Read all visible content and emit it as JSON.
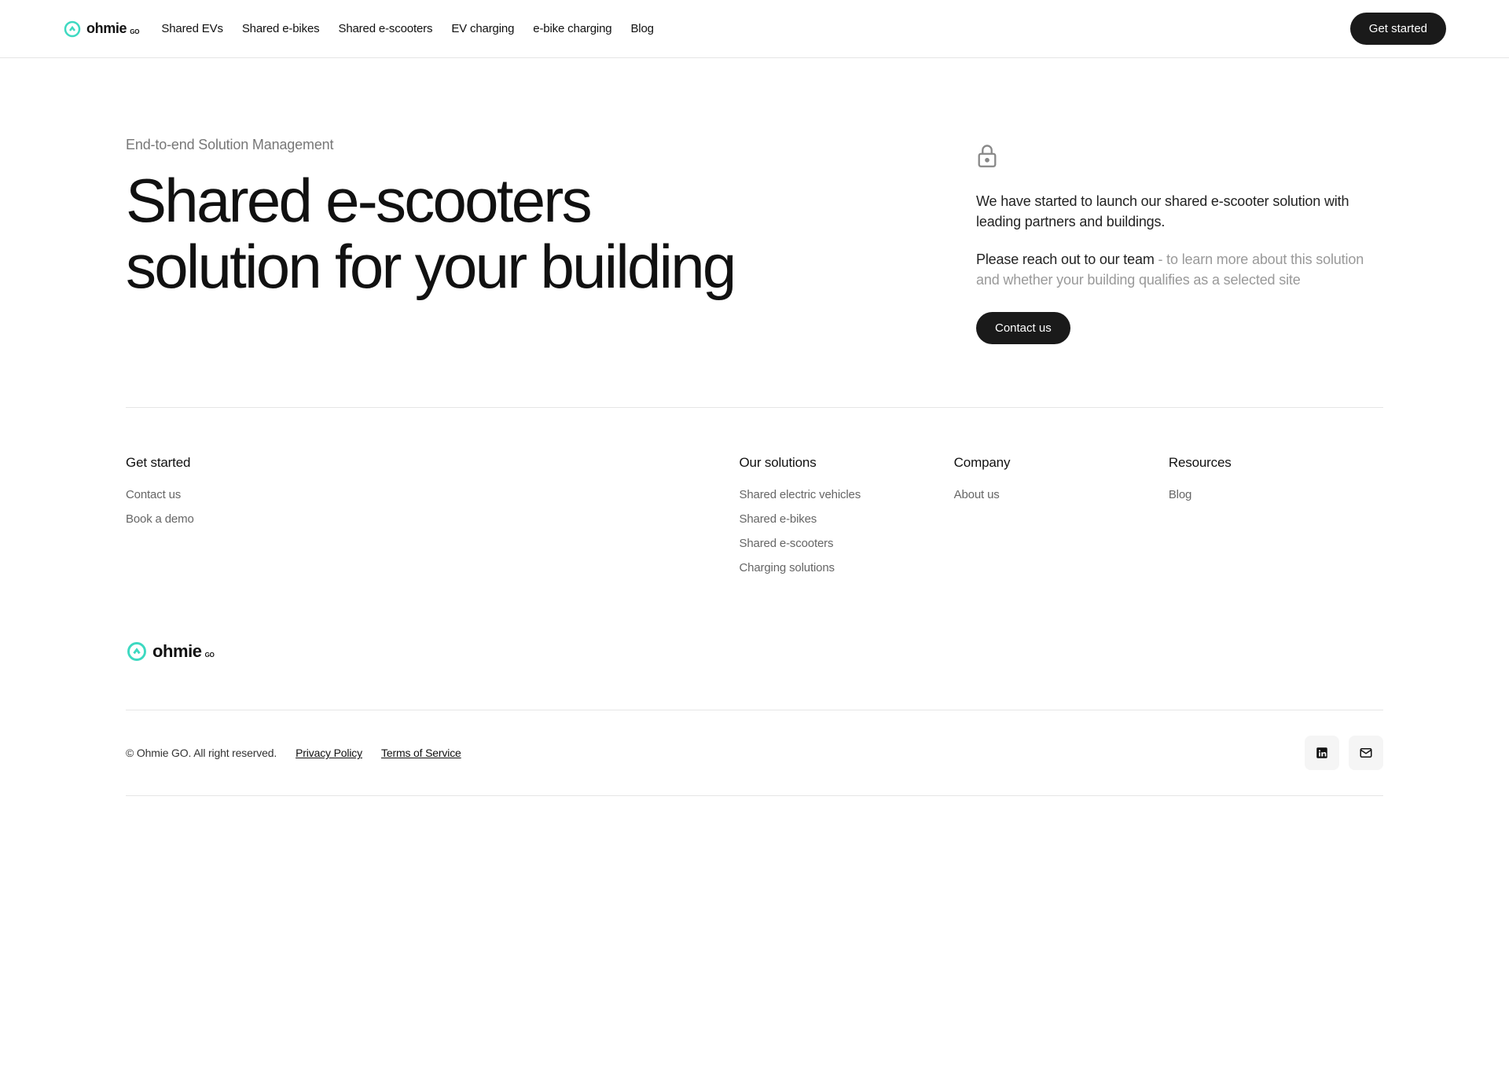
{
  "header": {
    "logo_text": "ohmie",
    "logo_sub": "GO",
    "nav": [
      "Shared EVs",
      "Shared e-bikes",
      "Shared e-scooters",
      "EV charging",
      "e-bike charging",
      "Blog"
    ],
    "cta": "Get started"
  },
  "hero": {
    "eyebrow": "End-to-end Solution Management",
    "title_line1": "Shared e-scooters",
    "title_line2": "solution for your building",
    "para1": "We have started to launch our shared e-scooter solution with leading partners and buildings.",
    "para2_strong": "Please reach out to our team",
    "para2_muted": " - to learn more about this solution and whether your building qualifies as a selected site",
    "cta": "Contact us"
  },
  "footer": {
    "col1": {
      "heading": "Get started",
      "links": [
        "Contact us",
        "Book a demo"
      ]
    },
    "col2": {
      "heading": "Our solutions",
      "links": [
        "Shared electric vehicles",
        "Shared e-bikes",
        "Shared e-scooters",
        "Charging solutions"
      ]
    },
    "col3": {
      "heading": "Company",
      "links": [
        "About us"
      ]
    },
    "col4": {
      "heading": "Resources",
      "links": [
        "Blog"
      ]
    },
    "copyright": "© Ohmie GO. All right reserved.",
    "privacy": "Privacy Policy",
    "terms": "Terms of Service"
  }
}
